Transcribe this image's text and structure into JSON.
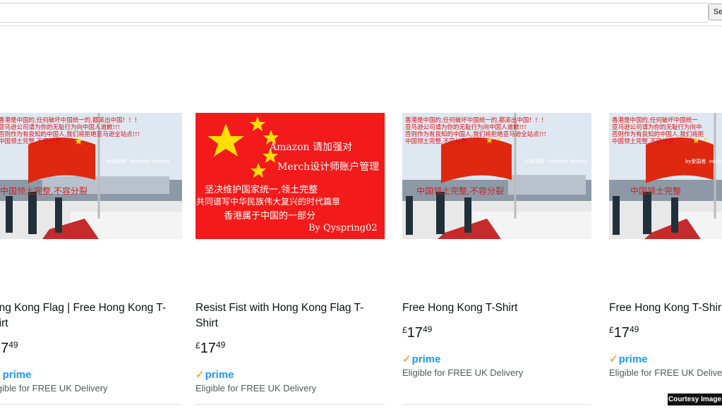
{
  "search": {
    "button_label": "Se"
  },
  "products": [
    {
      "title": "ong Kong Flag | Free Hong Kong T-\nhirt",
      "currency": "",
      "price_whole": "17",
      "price_frac": "49",
      "prime": "prime",
      "delivery": "ligible for FREE UK Delivery",
      "image": {
        "kind": "flag-photo",
        "text": "香港是中国的,任何破坏中国统一的,都滚出中国！！！\n亚马逊公司请为你的无耻行为向中国人道歉!!!\n否则作为有良知的中国人,我们将拒绝亚马逊全站点!!!\n中国领土完整,不容分裂",
        "signature": "by爱国者  edmund herang"
      }
    },
    {
      "title": "Resist Fist with Hong Kong Flag T-\nShirt",
      "currency": "£",
      "price_whole": "17",
      "price_frac": "49",
      "prime": "prime",
      "delivery": "Eligible for FREE UK Delivery",
      "image": {
        "kind": "poster",
        "line1": "Amazon 请加强对",
        "line2": "Merch设计师账户管理",
        "line3": "坚决维护国家统一,领土完整",
        "line4": "共同谱写中华民族伟大复兴的时代篇章",
        "line5": "香港属于中国的一部分",
        "line6": "By Qyspring02"
      }
    },
    {
      "title": "Free Hong Kong T-Shirt",
      "currency": "£",
      "price_whole": "17",
      "price_frac": "49",
      "prime": "prime",
      "delivery": "Eligible for FREE UK Delivery",
      "image": {
        "kind": "flag-photo",
        "text": "香港是中国的,任何破坏中国统一的,都滚出中国！！！\n亚马逊公司请为你的无耻行为向中国人道歉!!!\n否则作为有良知的中国人,我们将拒绝亚马逊全站点!!!\n中国领土完整,不容分裂",
        "signature": "by爱国者  edmund herang"
      }
    },
    {
      "title": "Free Hong Kong T-Shir",
      "currency": "£",
      "price_whole": "17",
      "price_frac": "49",
      "prime": "prime",
      "delivery": "Eligible for FREE UK Deliver",
      "image": {
        "kind": "flag-photo",
        "text": "香港是中国的,任何破坏中国统一\n亚马逊公司请为你的无耻行为向中\n否则作为有良知的中国人,我们将拒\n中国领土完整,不容分裂",
        "signature": "by爱国者  edmund"
      }
    }
  ],
  "credit": "Courtesy Image",
  "colors": {
    "flag_red": "#de2910",
    "star_yellow": "#ffde00",
    "prime_blue": "#1a98ff",
    "prime_check": "#f3a847"
  }
}
